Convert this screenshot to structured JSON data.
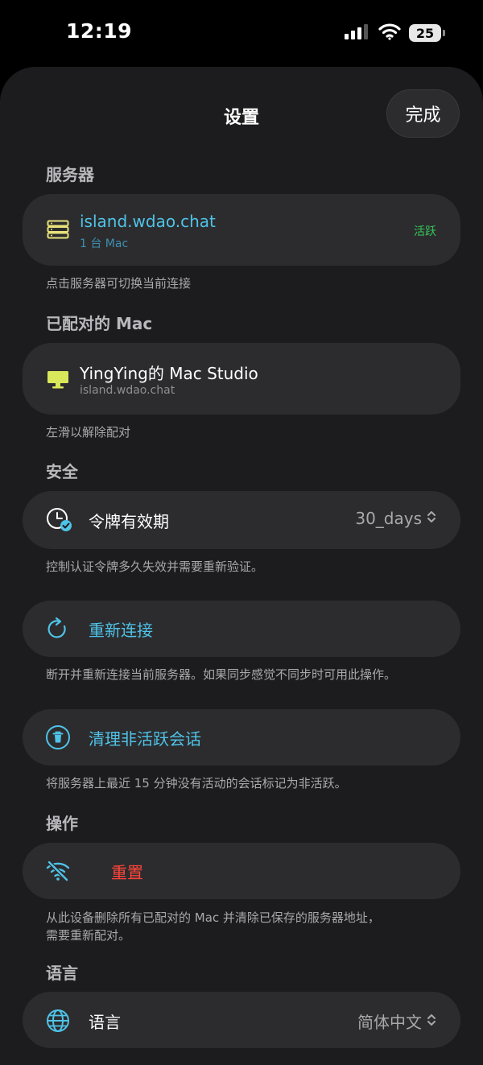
{
  "status_bar": {
    "time": "12:19",
    "battery": "25"
  },
  "nav": {
    "title": "设置",
    "done_label": "完成"
  },
  "sections": {
    "server": {
      "header": "服务器",
      "host": "island.wdao.chat",
      "sub": "1 台 Mac",
      "status": "活跃",
      "footnote": "点击服务器可切换当前连接"
    },
    "paired": {
      "header": "已配对的 Mac",
      "name": "YingYing的 Mac Studio",
      "sub": "island.wdao.chat",
      "footnote": "左滑以解除配对"
    },
    "security": {
      "header": "安全",
      "token_label": "令牌有效期",
      "token_value": "30_days",
      "footnote": "控制认证令牌多久失效并需要重新验证。"
    },
    "reconnect": {
      "label": "重新连接",
      "footnote": "断开并重新连接当前服务器。如果同步感觉不同步时可用此操作。"
    },
    "cleanup": {
      "label": "清理非活跃会话",
      "footnote": "将服务器上最近 15 分钟没有活动的会话标记为非活跃。"
    },
    "actions": {
      "header": "操作",
      "reset_label": "重置",
      "footnote_line1": "从此设备删除所有已配对的 Mac 并清除已保存的服务器地址，",
      "footnote_line2": "需要重新配对。"
    },
    "language": {
      "header": "语言",
      "label": "语言",
      "value": "简体中文"
    }
  },
  "colors": {
    "accent": "#4fc3e8",
    "server_icon": "#e9e27a",
    "active_green": "#34c759",
    "danger": "#ff453a"
  }
}
